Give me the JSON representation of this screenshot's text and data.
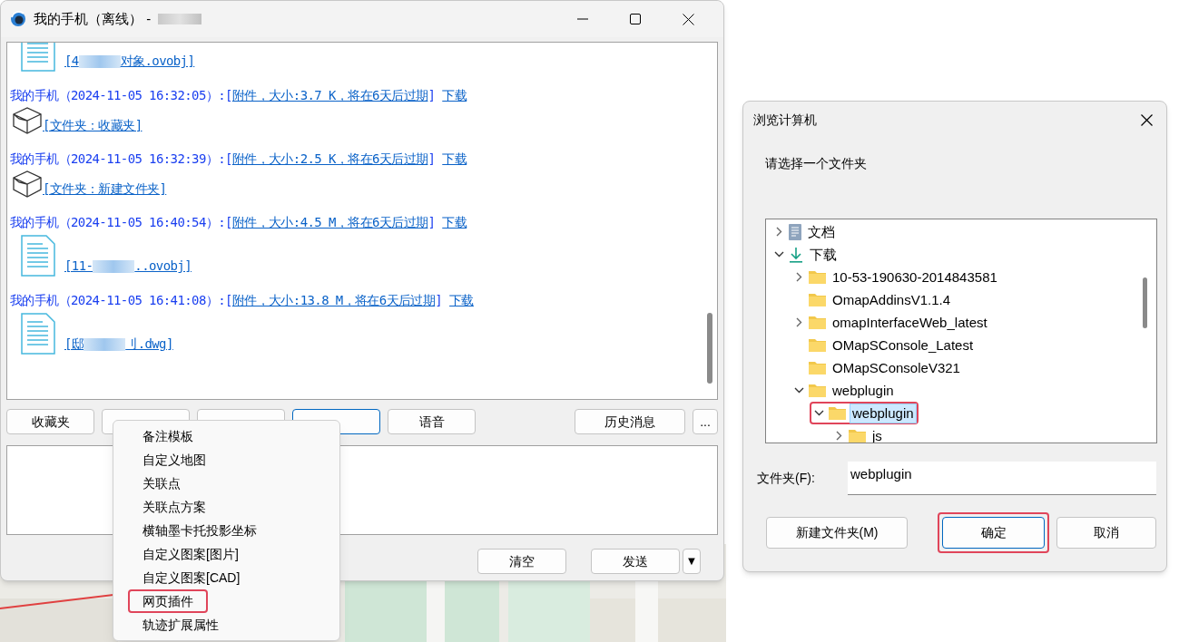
{
  "main_window": {
    "title": "我的手机（离线） -",
    "title_redacted": true
  },
  "messages": [
    {
      "file": {
        "kind": "document",
        "parts": [
          "[4",
          "对象.ovobj]"
        ]
      }
    },
    {
      "header": {
        "sender": "我的手机（2024-11-05 16:32:05）:[",
        "attachment": "附件，大小:3.7 K，将在6天后过期",
        "close": "]",
        "download": "下载"
      },
      "file": {
        "kind": "folder",
        "parts": [
          "[文件夹：收藏夹]"
        ]
      }
    },
    {
      "header": {
        "sender": "我的手机（2024-11-05 16:32:39）:[",
        "attachment": "附件，大小:2.5 K，将在6天后过期",
        "close": "]",
        "download": "下载"
      },
      "file": {
        "kind": "folder",
        "parts": [
          "[文件夹：新建文件夹]"
        ]
      }
    },
    {
      "header": {
        "sender": "我的手机（2024-11-05 16:40:54）:[",
        "attachment": "附件，大小:4.5 M，将在6天后过期",
        "close": "]",
        "download": "下载"
      },
      "file": {
        "kind": "document",
        "parts": [
          "[11-",
          "..ovobj]"
        ]
      }
    },
    {
      "header": {
        "sender": "我的手机（2024-11-05 16:41:08）:[",
        "attachment": "附件，大小:13.8 M，将在6天后过期",
        "close": "]",
        "download": "下载"
      },
      "file": {
        "kind": "document",
        "parts": [
          "[邸",
          "刂.dwg]"
        ]
      }
    }
  ],
  "toolbar": [
    {
      "label": "收藏夹",
      "focused": false
    },
    {
      "focused": false
    },
    {
      "focused": false
    },
    {
      "focused": true
    },
    {
      "label": "语音",
      "focused": false
    },
    {
      "label": "历史消息",
      "focused": false
    },
    {
      "label": "...",
      "focused": false
    }
  ],
  "send_buttons": {
    "clear": "清空",
    "send": "发送",
    "dropdown": "▼"
  },
  "context_menu": [
    {
      "label": "备注模板",
      "highlighted": false
    },
    {
      "label": "自定义地图",
      "highlighted": false
    },
    {
      "label": "关联点",
      "highlighted": false
    },
    {
      "label": "关联点方案",
      "highlighted": false
    },
    {
      "label": "横轴墨卡托投影坐标",
      "highlighted": false
    },
    {
      "label": "自定义图案[图片]",
      "highlighted": false
    },
    {
      "label": "自定义图案[CAD]",
      "highlighted": false
    },
    {
      "label": "网页插件",
      "highlighted": true
    },
    {
      "label": "轨迹扩展属性",
      "highlighted": false
    }
  ],
  "dialog": {
    "title": "浏览计算机",
    "prompt": "请选择一个文件夹",
    "tree": [
      {
        "label": "文档",
        "kind": "document",
        "has_children": true,
        "expanded": false,
        "selected": false
      },
      {
        "label": "下载",
        "kind": "download",
        "has_children": true,
        "expanded": true,
        "selected": false,
        "children": [
          {
            "label": "10-53-190630-2014843581",
            "kind": "folder",
            "has_children": true,
            "expanded": false,
            "selected": false
          },
          {
            "label": "OmapAddinsV1.1.4",
            "kind": "folder",
            "has_children": false,
            "expanded": false,
            "selected": false
          },
          {
            "label": "omapInterfaceWeb_latest",
            "kind": "folder",
            "has_children": true,
            "expanded": false,
            "selected": false
          },
          {
            "label": "OMapSConsole_Latest",
            "kind": "folder",
            "has_children": false,
            "expanded": false,
            "selected": false
          },
          {
            "label": "OMapSConsoleV321",
            "kind": "folder",
            "has_children": false,
            "expanded": false,
            "selected": false
          },
          {
            "label": "webplugin",
            "kind": "folder",
            "has_children": true,
            "expanded": true,
            "selected": false,
            "children": [
              {
                "label": "webplugin",
                "kind": "folder",
                "has_children": true,
                "expanded": true,
                "selected": true,
                "highlighted": true,
                "children": [
                  {
                    "label": "js",
                    "kind": "folder",
                    "has_children": true,
                    "expanded": false,
                    "selected": false
                  }
                ]
              }
            ]
          }
        ]
      }
    ],
    "folder_label": "文件夹(F):",
    "folder_value": "webplugin",
    "buttons": [
      {
        "label": "新建文件夹(M)",
        "kind": "new",
        "highlighted": false
      },
      {
        "label": "确定",
        "kind": "ok",
        "highlighted": true
      },
      {
        "label": "取消",
        "kind": "cancel",
        "highlighted": false
      }
    ]
  }
}
